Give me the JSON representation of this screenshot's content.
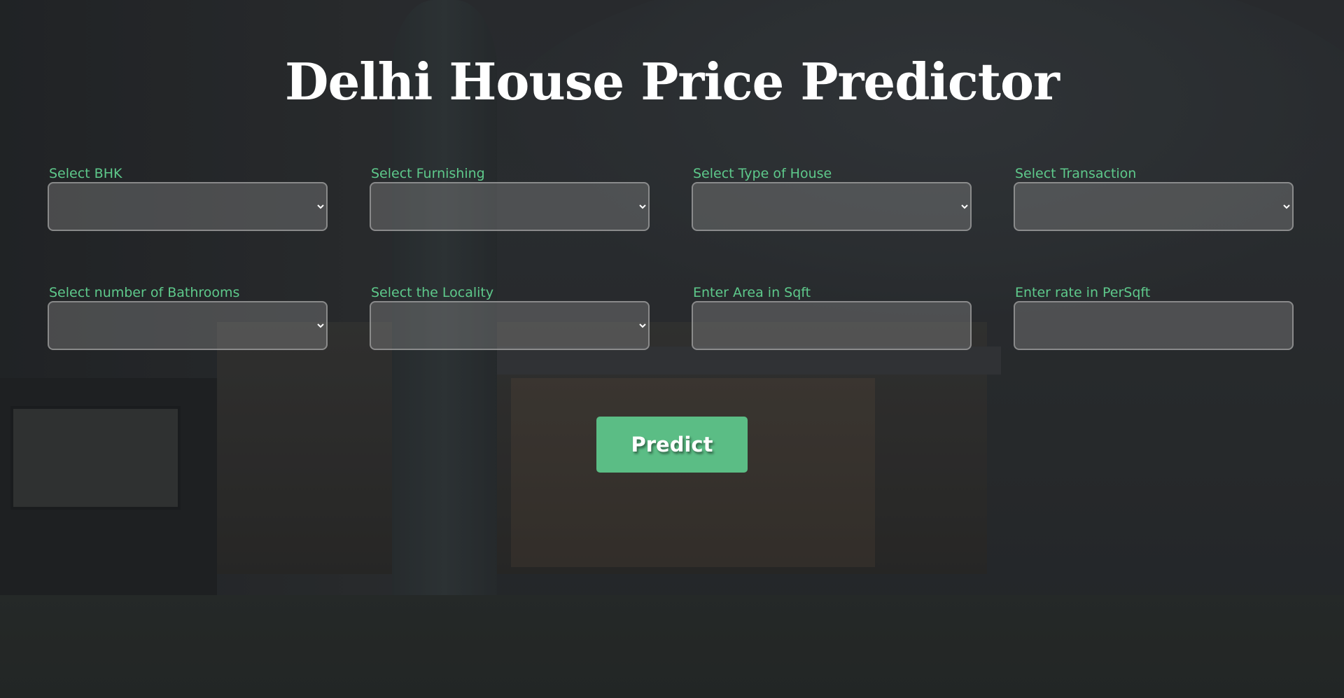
{
  "page": {
    "title": "Delhi House Price Predictor"
  },
  "form": {
    "fields": [
      {
        "label": "Select BHK",
        "value": ""
      },
      {
        "label": "Select Furnishing",
        "value": ""
      },
      {
        "label": "Select Type of House",
        "value": ""
      },
      {
        "label": "Select Transaction",
        "value": ""
      },
      {
        "label": "Select number of Bathrooms",
        "value": ""
      },
      {
        "label": "Select the Locality",
        "value": ""
      },
      {
        "label": "Enter Area in Sqft",
        "value": ""
      },
      {
        "label": "Enter rate in PerSqft",
        "value": ""
      }
    ],
    "submit_label": "Predict"
  },
  "colors": {
    "label_accent": "#5ec98b",
    "button_bg": "#5bbd85",
    "title_text": "#ffffff"
  }
}
